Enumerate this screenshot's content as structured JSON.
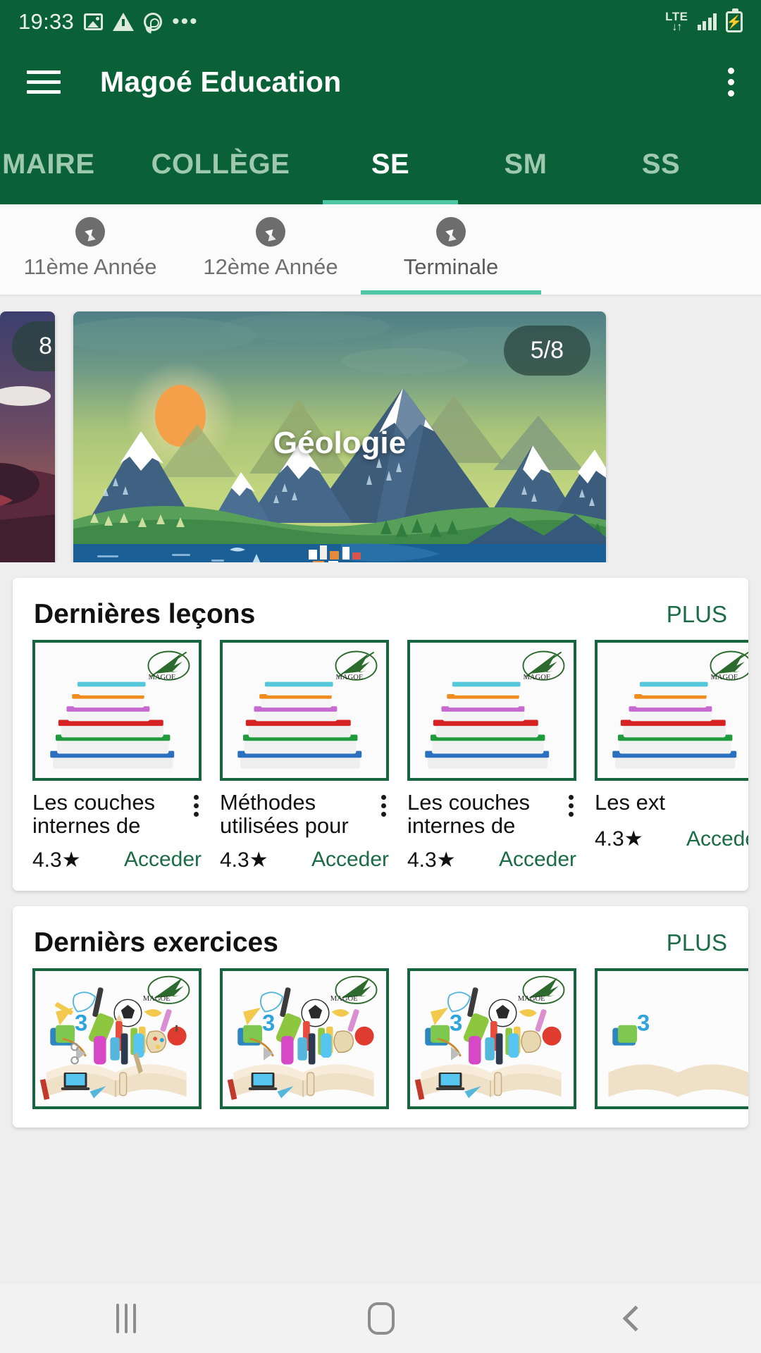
{
  "status_bar": {
    "time": "19:33",
    "left_icons": [
      "image-icon",
      "warning-icon",
      "whatsapp-icon",
      "more-icon"
    ],
    "network_label": "LTE",
    "right_icons": [
      "lte-data-icon",
      "signal-bars-icon",
      "battery-charging-icon"
    ]
  },
  "app_bar": {
    "menu_icon": "hamburger-menu-icon",
    "title": "Magoé Education",
    "overflow_icon": "overflow-menu-icon"
  },
  "top_tabs": {
    "items": [
      {
        "label": "IMAIRE",
        "active": false
      },
      {
        "label": "COLLÈGE",
        "active": false
      },
      {
        "label": "SE",
        "active": true
      },
      {
        "label": "SM",
        "active": false
      },
      {
        "label": "SS",
        "active": false
      }
    ],
    "indicator_color": "#4fc7a4"
  },
  "sub_tabs": {
    "items": [
      {
        "label": "11ème Année",
        "icon": "compass-icon",
        "active": false
      },
      {
        "label": "12ème Année",
        "icon": "compass-icon",
        "active": false
      },
      {
        "label": "Terminale",
        "icon": "compass-icon",
        "active": true
      }
    ]
  },
  "carousel": {
    "previous_card": {
      "badge": "8",
      "title": ""
    },
    "current_card": {
      "badge": "5/8",
      "title": "Géologie"
    }
  },
  "sections": [
    {
      "title": "Dernières leçons",
      "more_label": "PLUS",
      "items": [
        {
          "title": "Les couches internes de",
          "rating": "4.3",
          "star": "★",
          "action": "Acceder",
          "thumb": "books-stack-image",
          "menu": "item-overflow-icon"
        },
        {
          "title": "Méthodes utilisées pour",
          "rating": "4.3",
          "star": "★",
          "action": "Acceder",
          "thumb": "books-stack-image",
          "menu": "item-overflow-icon"
        },
        {
          "title": "Les couches internes de",
          "rating": "4.3",
          "star": "★",
          "action": "Acceder",
          "thumb": "books-stack-image",
          "menu": "item-overflow-icon"
        },
        {
          "title": "Les ext",
          "rating": "4.3",
          "star": "★",
          "action": "Acceder",
          "thumb": "books-stack-image",
          "menu": "item-overflow-icon"
        }
      ]
    },
    {
      "title": "Dernièrs exercices",
      "more_label": "PLUS",
      "items": [
        {
          "title": "",
          "rating": "",
          "star": "",
          "action": "",
          "thumb": "open-book-supplies-image",
          "menu": "item-overflow-icon"
        },
        {
          "title": "",
          "rating": "",
          "star": "",
          "action": "",
          "thumb": "open-book-supplies-image",
          "menu": "item-overflow-icon"
        },
        {
          "title": "",
          "rating": "",
          "star": "",
          "action": "",
          "thumb": "open-book-supplies-image",
          "menu": "item-overflow-icon"
        },
        {
          "title": "",
          "rating": "",
          "star": "",
          "action": "",
          "thumb": "open-book-supplies-image",
          "menu": "item-overflow-icon"
        }
      ]
    }
  ],
  "nav_bar": {
    "recents": "recents-icon",
    "home": "home-icon",
    "back": "back-icon"
  },
  "colors": {
    "brand_green": "#0a6138",
    "accent_teal": "#4fc7a4",
    "link_green": "#1b6b46",
    "thumb_border": "#16653e"
  },
  "logo_text": "MAGOE"
}
